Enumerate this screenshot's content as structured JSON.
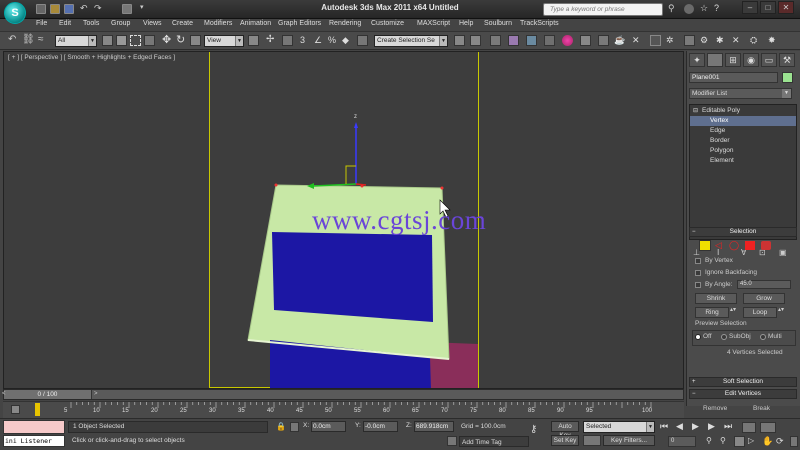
{
  "titlebar": {
    "app_logo": "S",
    "title": "Autodesk 3ds Max  2011 x64       Untitled",
    "search_placeholder": "Type a keyword or phrase",
    "win_min": "–",
    "win_max": "□",
    "win_close": "✕"
  },
  "menu": [
    "File",
    "Edit",
    "Tools",
    "Group",
    "Views",
    "Create",
    "Modifiers",
    "Animation",
    "Graph Editors",
    "Rendering",
    "Customize",
    "MAXScript",
    "Help",
    "Soulburn",
    "TrackScripts"
  ],
  "toolbar": {
    "selection_filter": "All",
    "ref_coord": "View",
    "named_selection": "Create Selection Se"
  },
  "viewport": {
    "label": "[ + ] [ Perspective ] [ Smooth + Highlights + Edged Faces ]",
    "watermark": "www.cgtsj.com",
    "gizmo_z": "z"
  },
  "command_panel": {
    "object_name": "Plane001",
    "object_color": "#9be391",
    "modifier_list": "Modifier List",
    "stack": [
      "Editable Poly",
      "Vertex",
      "Edge",
      "Border",
      "Polygon",
      "Element"
    ],
    "selected_subobject": "Vertex",
    "selection_rollout": {
      "title": "Selection",
      "by_vertex": "By Vertex",
      "ignore_backfacing": "Ignore Backfacing",
      "by_angle": "By Angle:",
      "by_angle_value": "45.0",
      "shrink": "Shrink",
      "grow": "Grow",
      "ring": "Ring",
      "loop": "Loop",
      "preview_selection": "Preview Selection",
      "preview_off": "Off",
      "preview_subobj": "SubObj",
      "preview_multi": "Multi",
      "status": "4 Vertices Selected"
    },
    "soft_selection": "Soft Selection",
    "edit_vertices": "Edit Vertices",
    "remove": "Remove",
    "break": "Break"
  },
  "timeline": {
    "frame_display": "0 / 100",
    "ticks": [
      "5",
      "10",
      "15",
      "20",
      "25",
      "30",
      "35",
      "40",
      "45",
      "50",
      "55",
      "60",
      "65",
      "70",
      "75",
      "80",
      "85",
      "90",
      "95",
      "100"
    ]
  },
  "status": {
    "listener": "ini Listener",
    "selected": "1 Object Selected",
    "prompt": "Click or click-and-drag to select objects",
    "x_label": "X:",
    "x": "0.0cm",
    "y_label": "Y:",
    "y": "-0.0cm",
    "z_label": "Z:",
    "z": "689.918cm",
    "grid": "Grid = 100.0cm",
    "add_time_tag": "Add Time Tag",
    "auto_key": "Auto Key",
    "set_key": "Set Key",
    "key_mode": "Selected",
    "key_filters": "Key Filters...",
    "frame": "0"
  }
}
